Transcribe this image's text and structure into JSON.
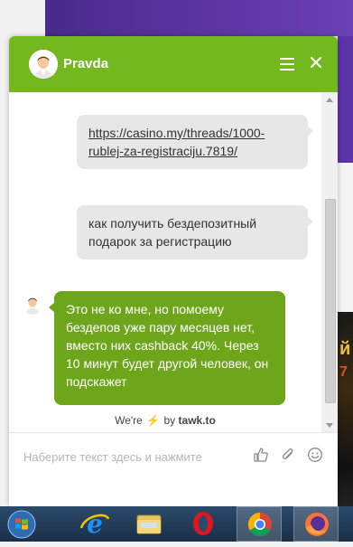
{
  "chat": {
    "agent_name": "Pravda",
    "messages": [
      {
        "sender": "visitor",
        "link_text": "https://casino.my/threads/1000-rublej-za-registraciju.7819/"
      },
      {
        "sender": "visitor",
        "text": "как получить бездепозитный подарок за регистрацию"
      },
      {
        "sender": "agent",
        "text": "Это не ко мне, но помоему бездепов уже пару месяцев нет, вместо них cashback 40%. Через 10 минут будет другой человек, он подскажет"
      }
    ],
    "branding": {
      "prefix": "We're",
      "suffix": "by",
      "brand": "tawk.to"
    },
    "input_placeholder": "Наберите текст здесь и нажмите"
  },
  "colors": {
    "header": "#73b81e",
    "agent_bubble": "#6da51b",
    "visitor_bubble": "#e7e7e7"
  },
  "icons": {
    "header": [
      "agent-avatar",
      "menu-icon",
      "close-icon"
    ],
    "input": [
      "thumbs-up-icon",
      "attachment-icon",
      "emoji-icon"
    ],
    "taskbar": [
      "windows-start-icon",
      "internet-explorer-icon",
      "file-explorer-icon",
      "opera-icon",
      "chrome-icon",
      "firefox-icon"
    ]
  },
  "background": {
    "game_text_1": "й",
    "game_text_2": "7"
  }
}
